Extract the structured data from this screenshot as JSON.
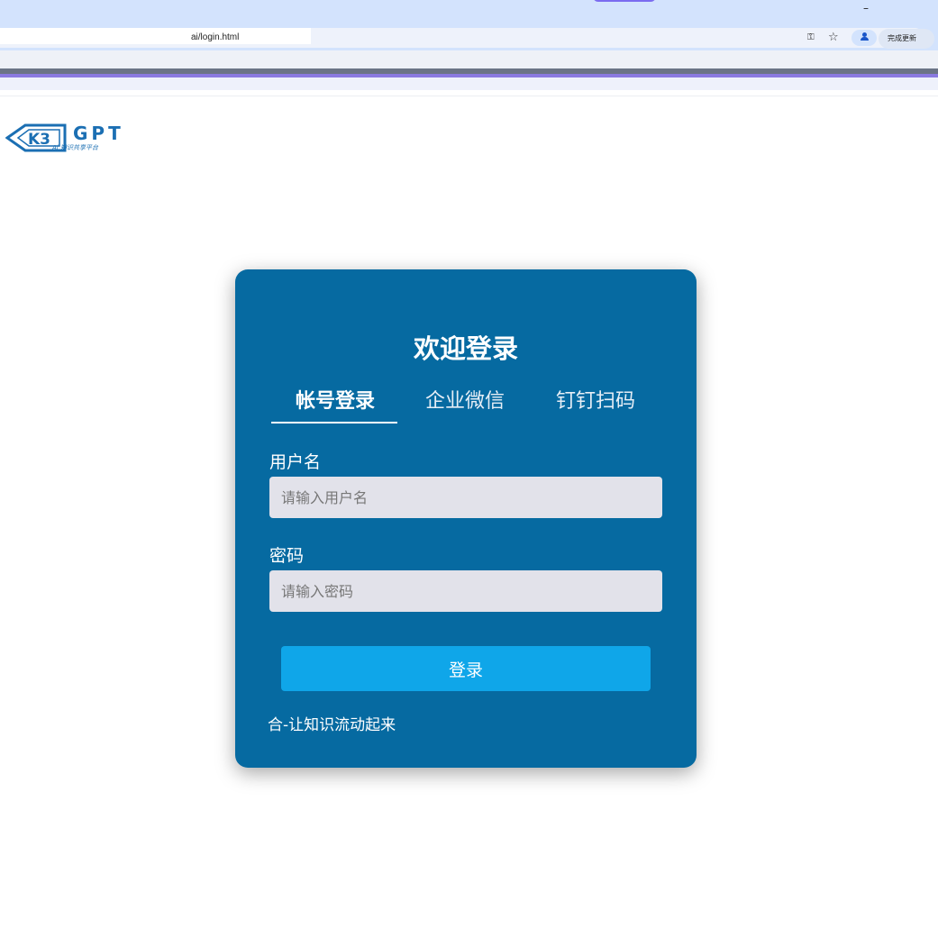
{
  "browser": {
    "url": "ai/login.html",
    "minimize_label": "–",
    "update_button_label": "完成更新",
    "key_icon": "key-icon",
    "star_icon": "star-icon",
    "profile_icon": "profile-icon",
    "accent_color": "#d3e3fd"
  },
  "logo": {
    "mark": "K3",
    "name": "GPT",
    "tagline": "Ai 知识共享平台"
  },
  "login": {
    "title": "欢迎登录",
    "tabs": [
      {
        "label": "帐号登录",
        "active": true
      },
      {
        "label": "企业微信",
        "active": false
      },
      {
        "label": "钉钉扫码",
        "active": false
      }
    ],
    "username_label": "用户名",
    "username_placeholder": "请输入用户名",
    "password_label": "密码",
    "password_placeholder": "请输入密码",
    "submit_label": "登录",
    "slogan": "合-让知识流动起来",
    "card_color": "#066aa1",
    "button_color": "#0fa6e9"
  }
}
